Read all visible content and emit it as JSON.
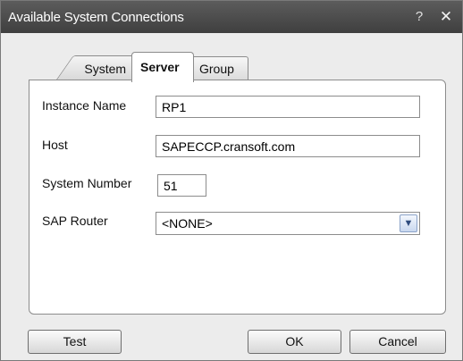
{
  "window": {
    "title": "Available System Connections",
    "help_glyph": "?",
    "close_glyph": "✕"
  },
  "tabs": [
    {
      "label": "System",
      "selected": false
    },
    {
      "label": "Server",
      "selected": true
    },
    {
      "label": "Group",
      "selected": false
    }
  ],
  "form": {
    "instance_name": {
      "label": "Instance Name",
      "value": "RP1"
    },
    "host": {
      "label": "Host",
      "value": "SAPECCP.cransoft.com"
    },
    "system_number": {
      "label": "System Number",
      "value": "51"
    },
    "sap_router": {
      "label": "SAP Router",
      "value": "<NONE>"
    }
  },
  "buttons": {
    "test": "Test",
    "ok": "OK",
    "cancel": "Cancel"
  },
  "icons": {
    "help": "help-icon",
    "close": "close-icon",
    "dropdown": "chevron-down-icon"
  }
}
